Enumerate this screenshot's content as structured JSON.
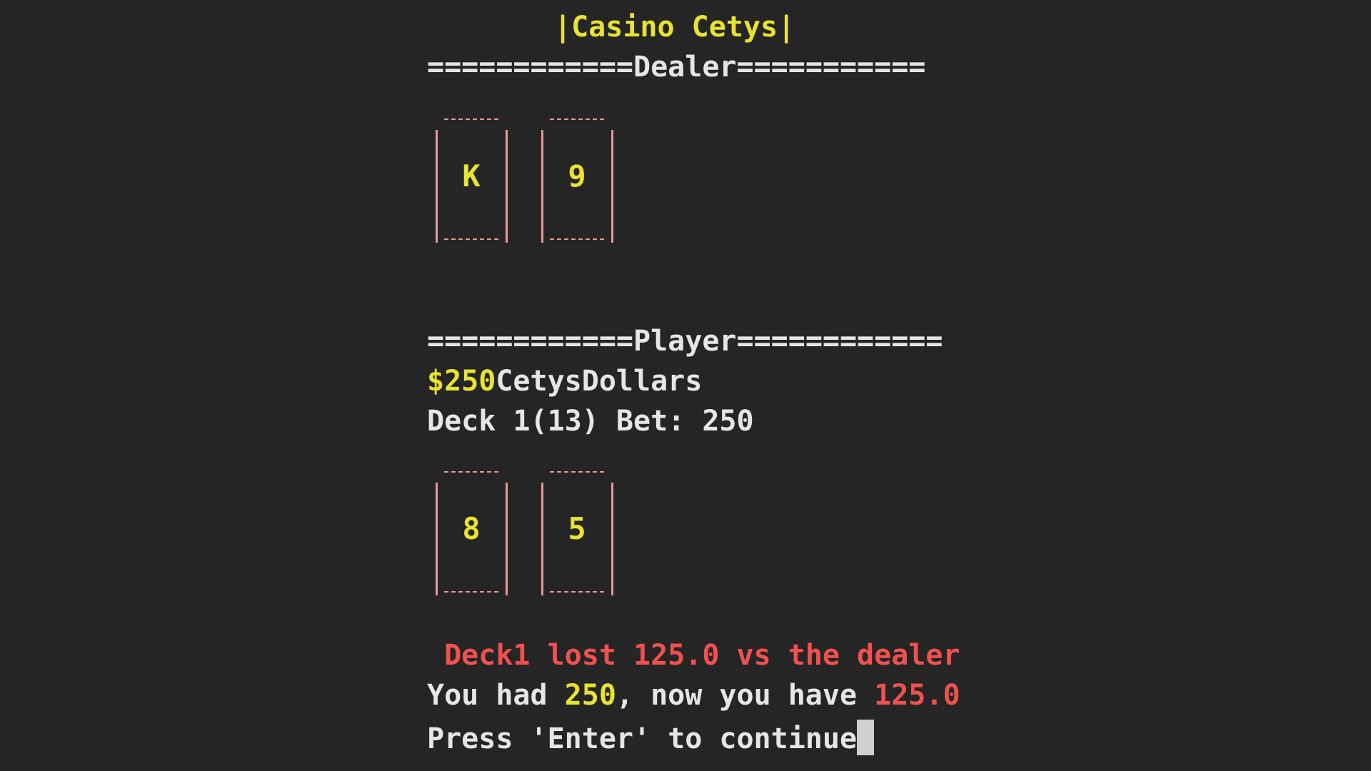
{
  "title": {
    "left_bar": "|",
    "text": "Casino Cetys",
    "right_bar": "|"
  },
  "dealer": {
    "header_left": "============",
    "header_label": "Dealer",
    "header_right": "===========",
    "cards": [
      "K",
      "9"
    ]
  },
  "player": {
    "header_left": "============",
    "header_label": "Player",
    "header_right": "============",
    "money_amount": "$250",
    "money_unit": "CetysDollars",
    "deck_info": "Deck 1(13) Bet: 250",
    "cards": [
      "8",
      "5"
    ]
  },
  "result": {
    "loss_message": " Deck1 lost 125.0 vs the dealer",
    "had_prefix": "You had ",
    "had_value": "250",
    "now_text": ", now you have ",
    "now_value": "125.0",
    "prompt": "Press 'Enter' to continue"
  },
  "colors": {
    "background": "#252526",
    "yellow": "#e8e330",
    "red": "#f0514f",
    "white": "#e6e6e6",
    "card_border": "#e59898"
  }
}
